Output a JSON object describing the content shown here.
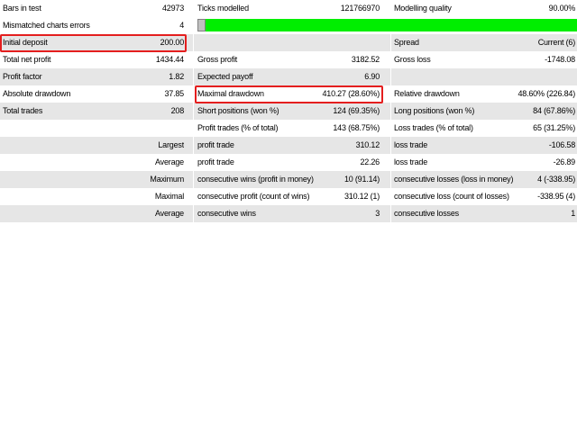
{
  "summary": {
    "bars_in_test": {
      "label": "Bars in test",
      "value": "42973"
    },
    "ticks_modelled": {
      "label": "Ticks modelled",
      "value": "121766970"
    },
    "modelling_quality": {
      "label": "Modelling quality",
      "value": "90.00%"
    },
    "mismatched_errors": {
      "label": "Mismatched charts errors",
      "value": "4"
    },
    "quality_fraction": 0.978,
    "initial_deposit": {
      "label": "Initial deposit",
      "value": "200.00"
    },
    "spread": {
      "label": "Spread",
      "value": "Current (6)"
    },
    "total_net_profit": {
      "label": "Total net profit",
      "value": "1434.44"
    },
    "gross_profit": {
      "label": "Gross profit",
      "value": "3182.52"
    },
    "gross_loss": {
      "label": "Gross loss",
      "value": "-1748.08"
    },
    "profit_factor": {
      "label": "Profit factor",
      "value": "1.82"
    },
    "expected_payoff": {
      "label": "Expected payoff",
      "value": "6.90"
    },
    "absolute_drawdown": {
      "label": "Absolute drawdown",
      "value": "37.85"
    },
    "maximal_drawdown": {
      "label": "Maximal drawdown",
      "value": "410.27 (28.60%)"
    },
    "relative_drawdown": {
      "label": "Relative drawdown",
      "value": "48.60% (226.84)"
    },
    "total_trades": {
      "label": "Total trades",
      "value": "208"
    },
    "short_positions": {
      "label": "Short positions (won %)",
      "value": "124 (69.35%)"
    },
    "long_positions": {
      "label": "Long positions (won %)",
      "value": "84 (67.86%)"
    },
    "profit_trades": {
      "label": "Profit trades (% of total)",
      "value": "143 (68.75%)"
    },
    "loss_trades": {
      "label": "Loss trades (% of total)",
      "value": "65 (31.25%)"
    }
  },
  "extremes": {
    "largest": {
      "label": "Largest",
      "profit_label": "profit trade",
      "profit_value": "310.12",
      "loss_label": "loss trade",
      "loss_value": "-106.58"
    },
    "average": {
      "label": "Average",
      "profit_label": "profit trade",
      "profit_value": "22.26",
      "loss_label": "loss trade",
      "loss_value": "-26.89"
    },
    "maximum": {
      "label": "Maximum",
      "profit_label": "consecutive wins (profit in money)",
      "profit_value": "10 (91.14)",
      "loss_label": "consecutive losses (loss in money)",
      "loss_value": "4 (-338.95)"
    },
    "maximal": {
      "label": "Maximal",
      "profit_label": "consecutive profit (count of wins)",
      "profit_value": "310.12 (1)",
      "loss_label": "consecutive loss (count of losses)",
      "loss_value": "-338.95 (4)"
    },
    "average_consecutive": {
      "label": "Average",
      "profit_label": "consecutive wins",
      "profit_value": "3",
      "loss_label": "consecutive losses",
      "loss_value": "1"
    }
  },
  "colors": {
    "highlight": "#e41e1e",
    "quality_bar": "#00ee00",
    "row_shade": "#e6e6e6"
  }
}
